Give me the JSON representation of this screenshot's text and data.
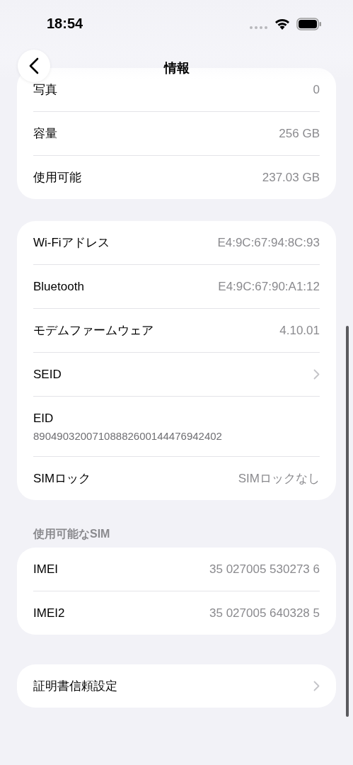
{
  "status_bar": {
    "time": "18:54"
  },
  "nav": {
    "title": "情報"
  },
  "groups": [
    {
      "rows": [
        {
          "kind": "value",
          "label": "写真",
          "value": "0"
        },
        {
          "kind": "value",
          "label": "容量",
          "value": "256 GB"
        },
        {
          "kind": "value",
          "label": "使用可能",
          "value": "237.03 GB"
        }
      ]
    },
    {
      "rows": [
        {
          "kind": "value",
          "label": "Wi-Fiアドレス",
          "value": "E4:9C:67:94:8C:93"
        },
        {
          "kind": "value",
          "label": "Bluetooth",
          "value": "E4:9C:67:90:A1:12"
        },
        {
          "kind": "value",
          "label": "モデムファームウェア",
          "value": "4.10.01"
        },
        {
          "kind": "link",
          "label": "SEID"
        },
        {
          "kind": "stacked",
          "label": "EID",
          "value": "89049032007108882600144476942402"
        },
        {
          "kind": "value",
          "label": "SIMロック",
          "value": "SIMロックなし"
        }
      ]
    },
    {
      "header": "使用可能なSIM",
      "rows": [
        {
          "kind": "value",
          "label": "IMEI",
          "value": "35 027005 530273 6"
        },
        {
          "kind": "value",
          "label": "IMEI2",
          "value": "35 027005 640328 5"
        }
      ]
    },
    {
      "rows": [
        {
          "kind": "link",
          "label": "証明書信頼設定"
        }
      ]
    }
  ]
}
